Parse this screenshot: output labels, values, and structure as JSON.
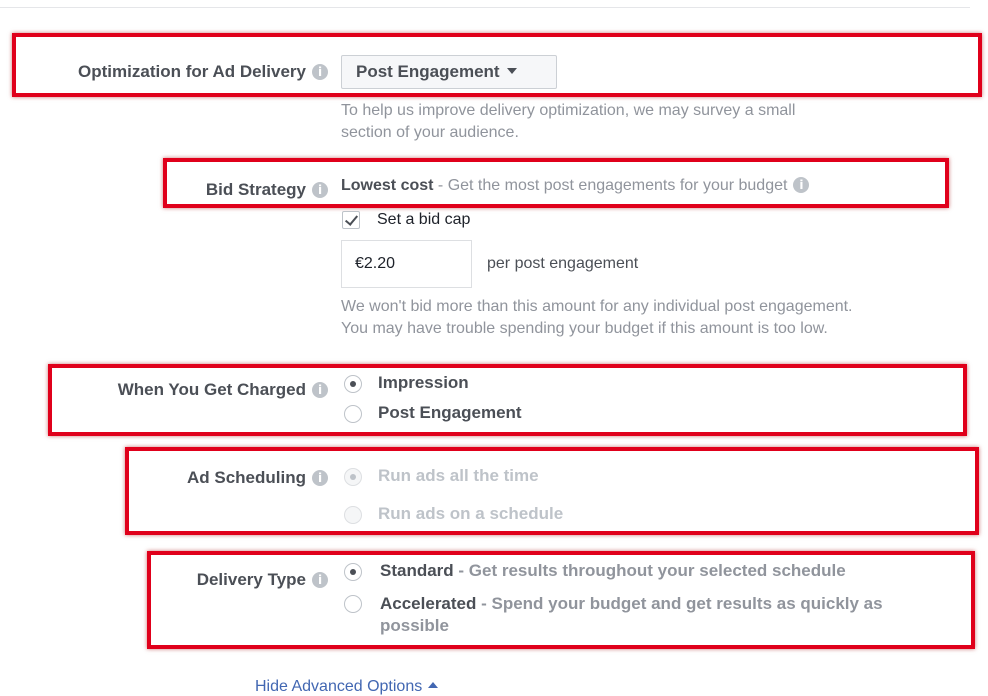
{
  "optimization": {
    "label": "Optimization for Ad Delivery",
    "selected": "Post Engagement",
    "help_line1": "To help us improve delivery optimization, we may survey a small",
    "help_line2": "section of your audience."
  },
  "bid_strategy": {
    "label": "Bid Strategy",
    "value": "Lowest cost",
    "description": " - Get the most post engagements for your budget",
    "bid_cap_label": "Set a bid cap",
    "bid_cap_checked": true,
    "bid_amount": "€2.20",
    "per_unit": "per post engagement",
    "help_line1": "We won't bid more than this amount for any individual post engagement.",
    "help_line2": "You may have trouble spending your budget if this amount is too low."
  },
  "charged": {
    "label": "When You Get Charged",
    "options": [
      "Impression",
      "Post Engagement"
    ],
    "selected": "Impression"
  },
  "scheduling": {
    "label": "Ad Scheduling",
    "options": [
      "Run ads all the time",
      "Run ads on a schedule"
    ],
    "selected": "Run ads all the time",
    "disabled": true
  },
  "delivery_type": {
    "label": "Delivery Type",
    "options": [
      {
        "name": "Standard",
        "description": " - Get results throughout your selected schedule"
      },
      {
        "name": "Accelerated",
        "description": " - Spend your budget and get results as quickly as",
        "description_cont": "possible"
      }
    ],
    "selected": "Standard"
  },
  "footer": {
    "link": "Hide Advanced Options"
  },
  "icons": {
    "info": "info-icon",
    "dropdown": "caret-down-icon",
    "collapse": "caret-up-icon",
    "check": "checkmark-icon"
  },
  "colors": {
    "highlight": "#e0001b",
    "link": "#4267b2",
    "label": "#4b4f56",
    "muted": "#90949c"
  }
}
